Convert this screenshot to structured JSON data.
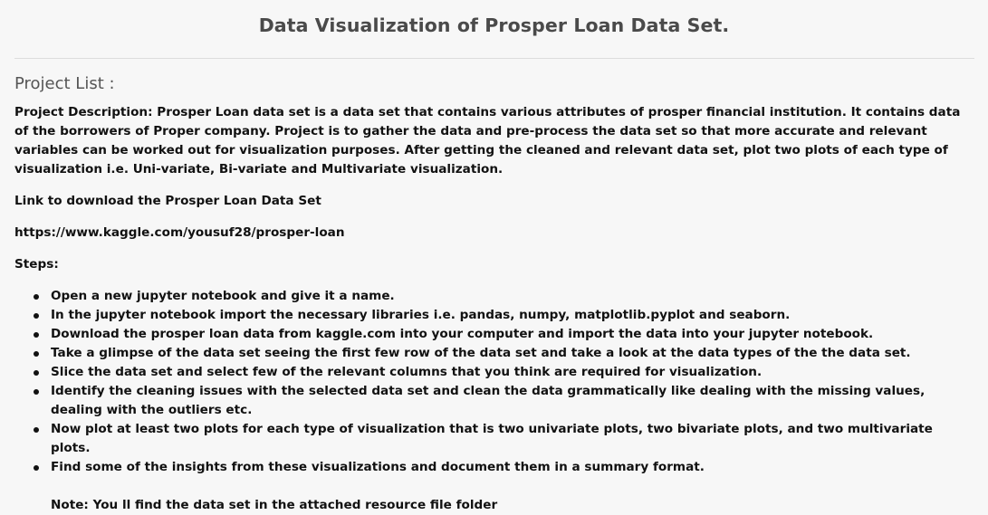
{
  "page": {
    "title": "Data Visualization of Prosper Loan Data Set."
  },
  "section": {
    "heading": "Project List :"
  },
  "description": {
    "label": "Project Description:",
    "text": " Prosper Loan data set is a data set that contains various attributes of prosper financial institution. It contains data of the borrowers of Proper company. Project is to gather the data and pre-process the data set so that more accurate and relevant variables can be worked out for visualization purposes. After getting the cleaned and relevant data set, plot two plots of each type of visualization i.e. Uni-variate, Bi-variate and Multivariate visualization."
  },
  "download": {
    "label": "Link to download the Prosper Loan Data Set",
    "url": "https://www.kaggle.com/yousuf28/prosper-loan"
  },
  "steps": {
    "label": "Steps:",
    "items": [
      "Open a new jupyter notebook and give it a name.",
      "In the jupyter notebook import the necessary libraries i.e. pandas, numpy, matplotlib.pyplot and seaborn.",
      "Download the prosper loan data from kaggle.com into your computer and import the data into your jupyter notebook.",
      "Take a glimpse of the data set seeing the first few row of the data set and take a look at the data types of the the data set.",
      "Slice the data set and select few of the relevant columns that you think are required for visualization.",
      "Identify the cleaning issues with the selected data set and clean the data grammatically like dealing with the missing values, dealing with the outliers etc.",
      "Now plot at least two plots for each type of visualization that is two univariate plots, two bivariate plots, and two multivariate plots.",
      "Find some of the insights from these visualizations and document them in a summary format."
    ],
    "note": "Note: You ll find the data set in the attached resource file folder"
  }
}
